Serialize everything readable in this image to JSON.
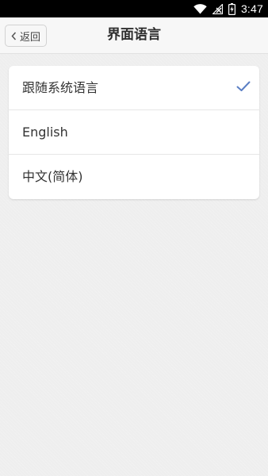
{
  "status_bar": {
    "time": "3:47",
    "icons": [
      "wifi-icon",
      "signal-icon",
      "battery-charging-icon"
    ]
  },
  "header": {
    "back_label": "返回",
    "title": "界面语言"
  },
  "languages": [
    {
      "label": "跟随系统语言",
      "selected": true
    },
    {
      "label": "English",
      "selected": false
    },
    {
      "label": "中文(简体)",
      "selected": false
    }
  ],
  "colors": {
    "check": "#5b7fc4",
    "status_bar_bg": "#000000",
    "nav_bg": "#f7f7f7",
    "page_bg": "#eeeeee"
  }
}
